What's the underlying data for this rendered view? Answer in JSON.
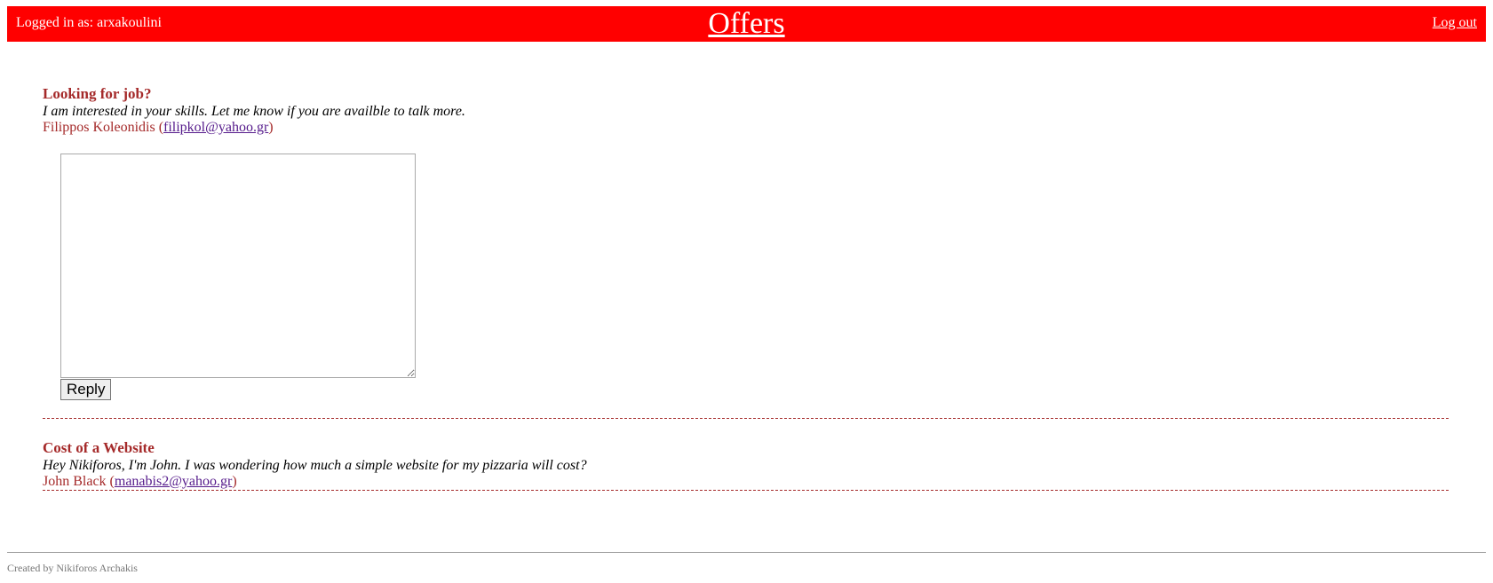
{
  "header": {
    "user_label": "Logged in as: arxakoulini",
    "title": "Offers",
    "logout_label": "Log out",
    "background_color": "#ff0000"
  },
  "offers": [
    {
      "title": "Looking for job?",
      "message": "I am interested in your skills. Let me know if you are availble to talk more.",
      "author": "Filippos Koleonidis",
      "email": "filipkol@yahoo.gr",
      "reply_button_label": "Reply"
    },
    {
      "title": "Cost of a Website",
      "message": "Hey Nikiforos, I'm John. I was wondering how much a simple website for my pizzaria will cost?",
      "author": "John Black",
      "email": "manabis2@yahoo.gr"
    }
  ],
  "footer": {
    "text": "Created by Nikiforos Archakis"
  },
  "colors": {
    "accent": "#a52a2a",
    "link": "#551a8b"
  }
}
